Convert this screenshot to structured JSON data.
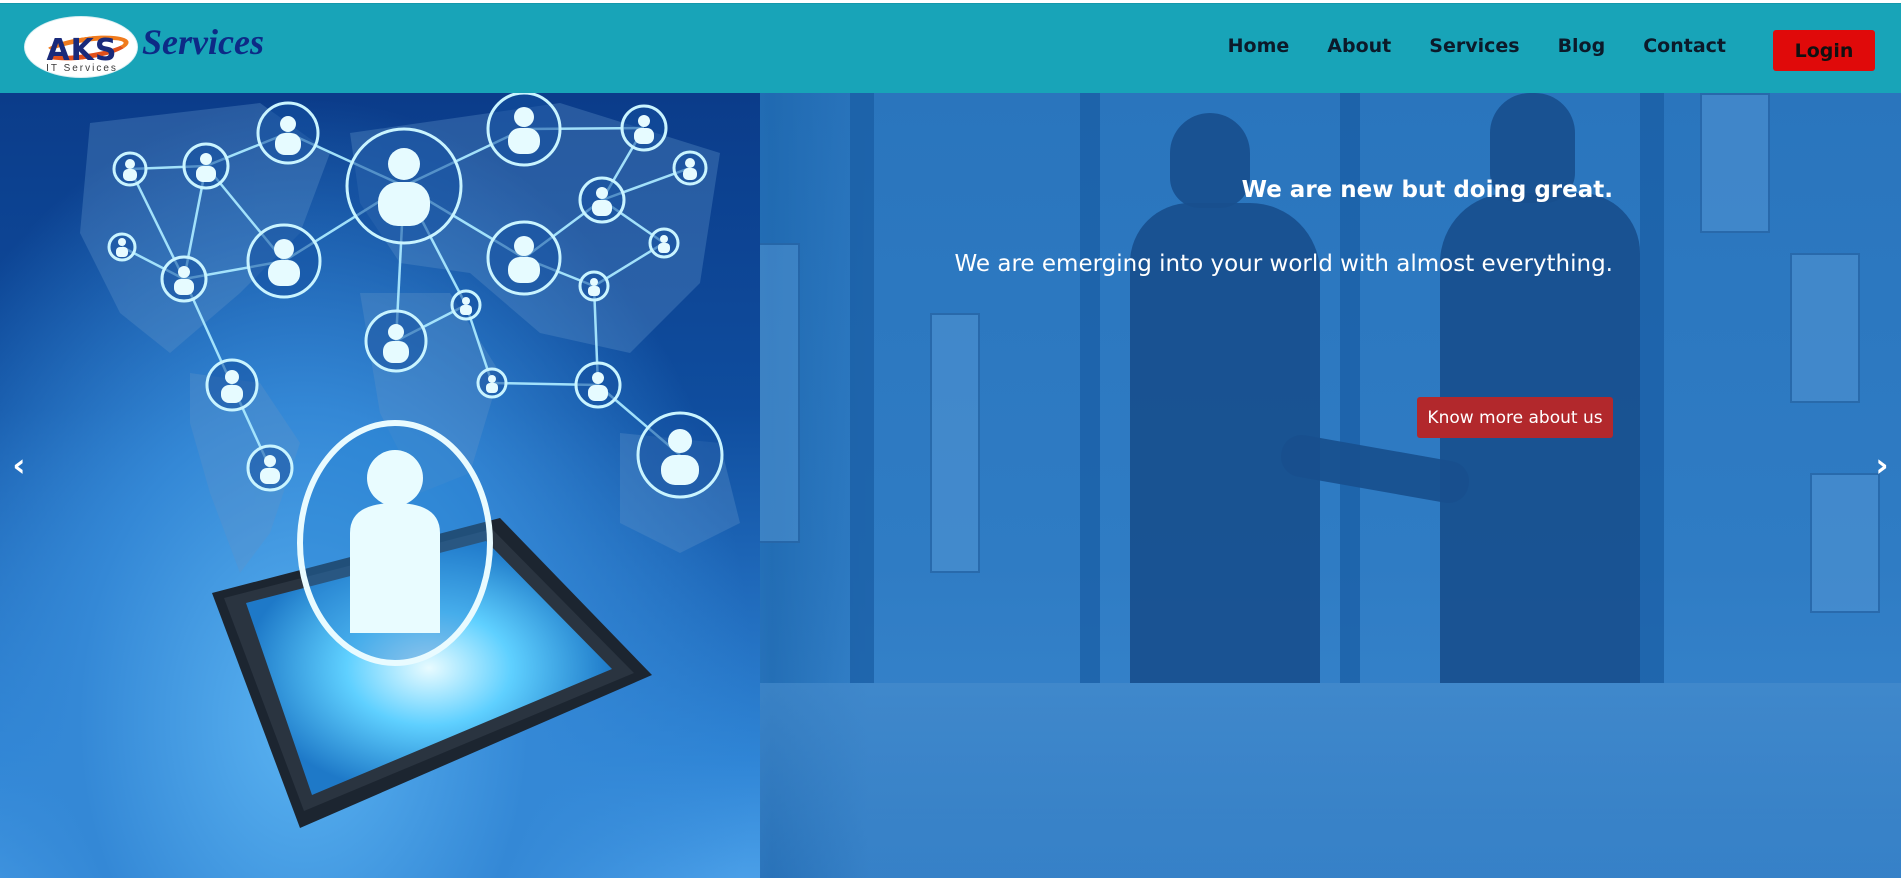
{
  "header": {
    "logo_letters": "AKS",
    "logo_tagline": "IT Services",
    "brand_name": "Services",
    "nav": [
      {
        "label": "Home"
      },
      {
        "label": "About"
      },
      {
        "label": "Services"
      },
      {
        "label": "Blog"
      },
      {
        "label": "Contact"
      }
    ],
    "login_label": "Login"
  },
  "hero": {
    "heading": "We are new but doing great.",
    "subheading": "We are emerging into your world with almost everything.",
    "cta_label": "Know more about us",
    "prev_glyph": "‹",
    "next_glyph": "›"
  },
  "colors": {
    "navbar": "#18a4b8",
    "login_button": "#e00a0a",
    "cta_button": "#b2282c",
    "brand_text": "#0d2a86"
  },
  "icons": [
    "chevron-left-icon",
    "chevron-right-icon"
  ]
}
